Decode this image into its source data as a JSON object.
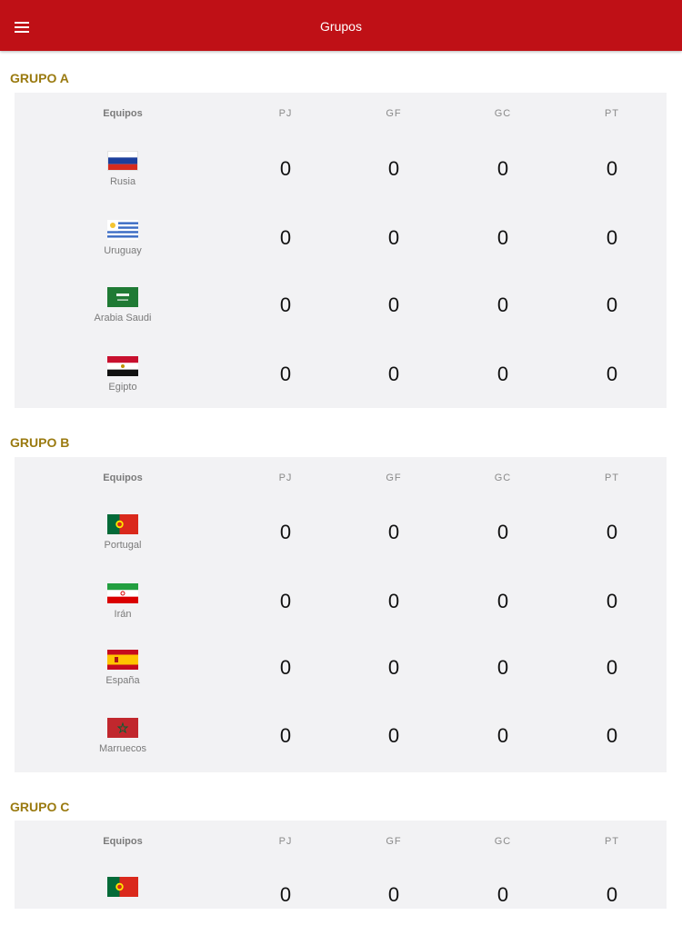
{
  "header": {
    "title": "Grupos",
    "menu_icon": "hamburger-menu-icon"
  },
  "columns": {
    "team": "Equipos",
    "pj": "PJ",
    "gf": "GF",
    "gc": "GC",
    "pt": "PT"
  },
  "groups": [
    {
      "title": "GRUPO A",
      "teams": [
        {
          "name": "Rusia",
          "flag": "russia-flag-icon",
          "pj": "0",
          "gf": "0",
          "gc": "0",
          "pt": "0"
        },
        {
          "name": "Uruguay",
          "flag": "uruguay-flag-icon",
          "pj": "0",
          "gf": "0",
          "gc": "0",
          "pt": "0"
        },
        {
          "name": "Arabia Saudi",
          "flag": "saudi-arabia-flag-icon",
          "pj": "0",
          "gf": "0",
          "gc": "0",
          "pt": "0"
        },
        {
          "name": "Egipto",
          "flag": "egypt-flag-icon",
          "pj": "0",
          "gf": "0",
          "gc": "0",
          "pt": "0"
        }
      ]
    },
    {
      "title": "GRUPO B",
      "teams": [
        {
          "name": "Portugal",
          "flag": "portugal-flag-icon",
          "pj": "0",
          "gf": "0",
          "gc": "0",
          "pt": "0"
        },
        {
          "name": "Irán",
          "flag": "iran-flag-icon",
          "pj": "0",
          "gf": "0",
          "gc": "0",
          "pt": "0"
        },
        {
          "name": "España",
          "flag": "spain-flag-icon",
          "pj": "0",
          "gf": "0",
          "gc": "0",
          "pt": "0"
        },
        {
          "name": "Marruecos",
          "flag": "morocco-flag-icon",
          "pj": "0",
          "gf": "0",
          "gc": "0",
          "pt": "0"
        }
      ]
    },
    {
      "title": "GRUPO C",
      "teams": [
        {
          "name": "",
          "flag": "portugal-flag-icon",
          "pj": "0",
          "gf": "0",
          "gc": "0",
          "pt": "0"
        }
      ]
    }
  ],
  "colors": {
    "appbar": "#bf1016",
    "group_title": "#9a7a10",
    "card_background": "#f2f2f4"
  }
}
